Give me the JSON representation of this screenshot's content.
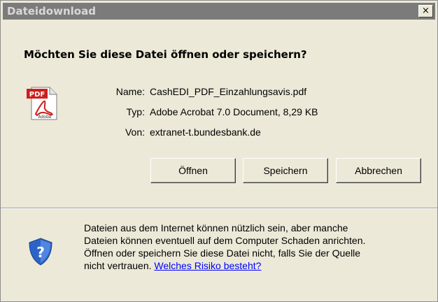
{
  "window": {
    "title": "Dateidownload",
    "close_label": "×"
  },
  "question": "Möchten Sie diese Datei öffnen oder speichern?",
  "file_info": {
    "name_label": "Name:",
    "name_value": "CashEDI_PDF_Einzahlungsavis.pdf",
    "type_label": "Typ:",
    "type_value": "Adobe Acrobat 7.0 Document, 8,29 KB",
    "from_label": "Von:",
    "from_value": "extranet-t.bundesbank.de"
  },
  "file_icon": {
    "name": "pdf-icon",
    "badge_text": "PDF",
    "brand_text": "Adobe"
  },
  "buttons": {
    "open": "Öffnen",
    "save": "Speichern",
    "cancel": "Abbrechen"
  },
  "warning": {
    "line1": "Dateien aus dem Internet können nützlich sein, aber manche",
    "line2": "Dateien können eventuell auf dem Computer Schaden anrichten.",
    "line3": "Öffnen oder speichern Sie diese Datei nicht, falls Sie der Quelle",
    "line4_prefix": "nicht vertrauen.",
    "link": "Welches Risiko besteht?"
  },
  "colors": {
    "titlebar": "#7b7b7b",
    "dialog_bg": "#ece9d8",
    "link": "#0000ff",
    "pdf_red": "#cc1f1f",
    "shield_blue": "#2d63c8"
  }
}
